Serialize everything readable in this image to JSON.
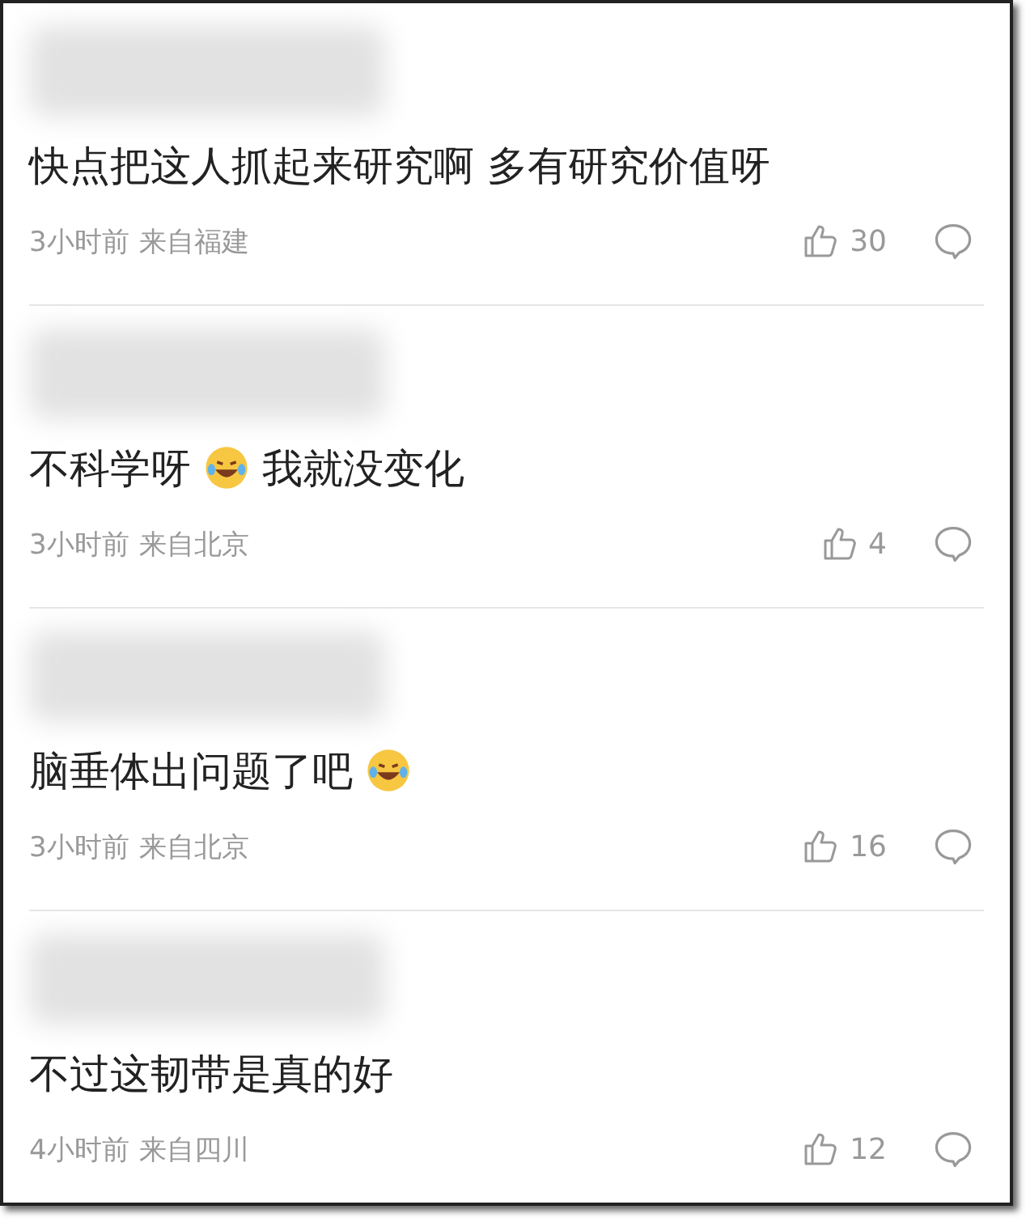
{
  "comments": [
    {
      "content": [
        {
          "kind": "text",
          "text": "快点把这人抓起来研究啊 多有研究价值呀"
        }
      ],
      "time": "3小时前",
      "location": "来自福建",
      "likes": "30"
    },
    {
      "content": [
        {
          "kind": "text",
          "text": "不科学呀"
        },
        {
          "kind": "emoji"
        },
        {
          "kind": "text",
          "text": "我就没变化"
        }
      ],
      "time": "3小时前",
      "location": "来自北京",
      "likes": "4"
    },
    {
      "content": [
        {
          "kind": "text",
          "text": "脑垂体出问题了吧"
        },
        {
          "kind": "emoji"
        }
      ],
      "time": "3小时前",
      "location": "来自北京",
      "likes": "16"
    },
    {
      "content": [
        {
          "kind": "text",
          "text": "不过这韧带是真的好"
        }
      ],
      "time": "4小时前",
      "location": "来自四川",
      "likes": "12"
    }
  ]
}
